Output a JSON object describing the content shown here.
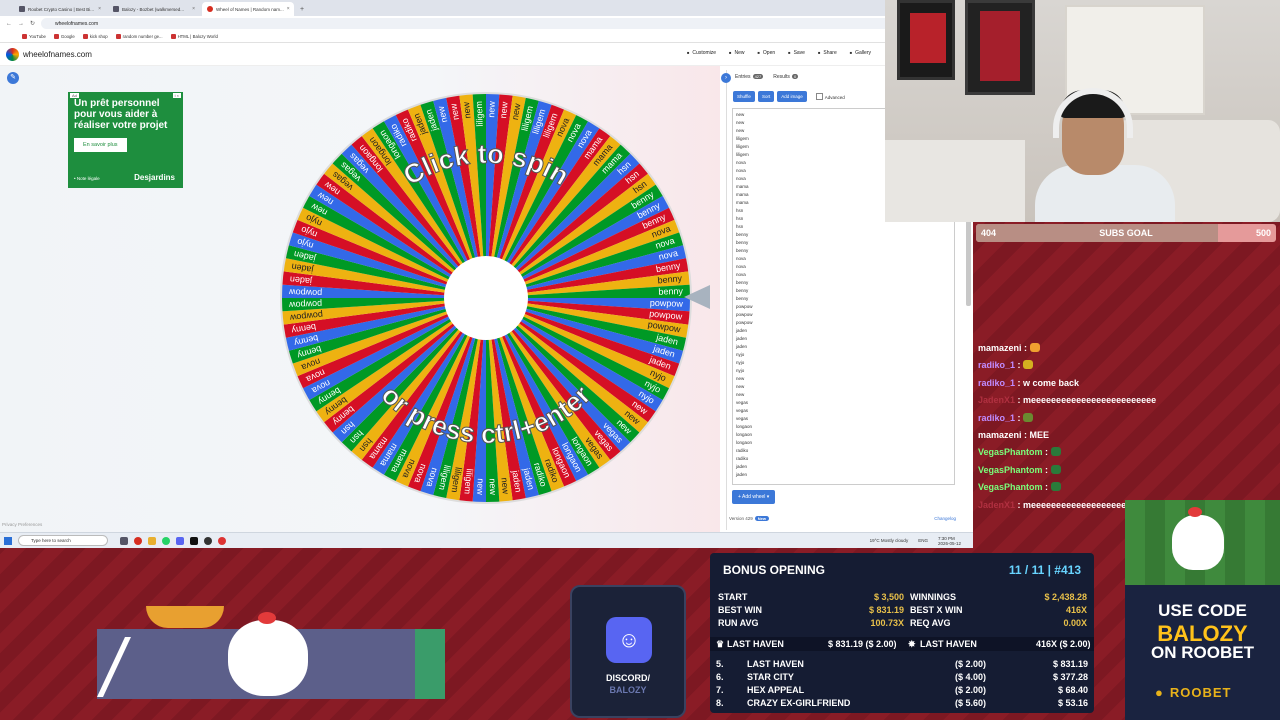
{
  "browser": {
    "tabs": [
      {
        "label": "Roobet Crypto Casino | Best Bi..."
      },
      {
        "label": "Balozy - Bozbet (walkmersed..."
      },
      {
        "label": "Wheel of Names | Random nam...",
        "active": true
      }
    ],
    "url": "wheelofnames.com",
    "bookmarks": [
      "YouTube",
      "Google",
      "kick shop",
      "random number ge...",
      "HTML | Balozy World"
    ]
  },
  "site": {
    "title": "wheelofnames.com",
    "header_buttons": [
      "Customize",
      "New",
      "Open",
      "Save",
      "Share",
      "Gallery"
    ],
    "privacy": "Privacy Preferences"
  },
  "ad": {
    "title": "Un prêt personnel pour vous aider à réaliser votre projet",
    "button": "En savoir plus",
    "footer": "• Note légale",
    "brand": "Desjardins",
    "tag": "Ad"
  },
  "wheel": {
    "text_top": "Click to spin",
    "text_bottom": "or press ctrl+enter",
    "colors": [
      "#3369e8",
      "#d50f25",
      "#eeb211",
      "#009925"
    ]
  },
  "panel": {
    "tab_entries": "Entries",
    "entries_count": "427",
    "tab_results": "Results",
    "results_count": "0",
    "shuffle": "Shuffle",
    "sort": "Sort",
    "add_image": "Add image",
    "advanced": "Advanced",
    "entries": [
      "new",
      "new",
      "new",
      "liligem",
      "liligem",
      "liligem",
      "nova",
      "nova",
      "nova",
      "mama",
      "mama",
      "mama",
      "hsn",
      "hsn",
      "hsn",
      "benny",
      "benny",
      "benny",
      "nova",
      "nova",
      "nova",
      "benny",
      "benny",
      "benny",
      "powpow",
      "powpow",
      "powpow",
      "jaden",
      "jaden",
      "jaden",
      "nyjo",
      "nyjo",
      "nyjo",
      "new",
      "new",
      "new",
      "vegas",
      "vegas",
      "vegas",
      "longaon",
      "longaon",
      "longaon",
      "radiko",
      "radiko",
      "jaden",
      "jaden"
    ],
    "add_wheel": "Add wheel",
    "version": "Version 429",
    "version_badge": "New",
    "changelog": "Changelog"
  },
  "taskbar": {
    "search_placeholder": "Type here to search",
    "weather": "19°C Mostly cloudy",
    "lang": "ENG",
    "time": "7:30 PM",
    "date": "2026-05-12"
  },
  "subs_goal": {
    "current": "404",
    "label": "SUBS GOAL",
    "target": "500",
    "progress": 0.808
  },
  "chat": [
    {
      "user": "mamazeni",
      "text": "",
      "emote": "#f0a030",
      "ucolor": "#ffffff"
    },
    {
      "user": "radiko_1",
      "text": "",
      "emote": "#d4b020",
      "ucolor": "#c08cff"
    },
    {
      "user": "radiko_1",
      "text": "w come back",
      "emote": "",
      "ucolor": "#c08cff"
    },
    {
      "user": "JadenX1",
      "text": "meeeeeeeeeeeeeeeeeeeeeeeee",
      "emote": "",
      "ucolor": "#b03040"
    },
    {
      "user": "radiko_1",
      "text": "",
      "emote": "#6a8a30",
      "ucolor": "#c08cff"
    },
    {
      "user": "mamazeni",
      "text": "MEE",
      "emote": "",
      "ucolor": "#ffffff"
    },
    {
      "user": "VegasPhantom",
      "text": "",
      "emote": "#2a7a3a",
      "ucolor": "#7aff7a"
    },
    {
      "user": "VegasPhantom",
      "text": "",
      "emote": "#2a7a3a",
      "ucolor": "#7aff7a"
    },
    {
      "user": "VegasPhantom",
      "text": "",
      "emote": "#2a7a3a",
      "ucolor": "#7aff7a"
    },
    {
      "user": "JadenX1",
      "text": "meeeeeeeeeeeeeeeeeeeeeeeee",
      "emote": "",
      "ucolor": "#b03040"
    }
  ],
  "promo": {
    "line1": "USE CODE",
    "line2": "BALOZY",
    "line3": "ON ROOBET",
    "brand": "ROOBET"
  },
  "discord": {
    "line1": "DISCORD/",
    "line2": "BALOZY"
  },
  "bonus": {
    "title": "BONUS OPENING",
    "counter": "11 / 11 | #413",
    "start_label": "START",
    "start": "$ 3,500",
    "winnings_label": "WINNINGS",
    "winnings": "$ 2,438.28",
    "bestwin_label": "BEST WIN",
    "bestwin": "$ 831.19",
    "bestx_label": "BEST X WIN",
    "bestx": "416X",
    "runavg_label": "RUN AVG",
    "runavg": "100.73X",
    "reqavg_label": "REQ AVG",
    "reqavg": "0.00X",
    "haven1": "LAST HAVEN",
    "haven1_val": "$ 831.19 ($ 2.00)",
    "haven2": "LAST HAVEN",
    "haven2_val": "416X ($ 2.00)",
    "rows": [
      {
        "num": "5.",
        "name": "LAST HAVEN",
        "bet": "($ 2.00)",
        "win": "$ 831.19"
      },
      {
        "num": "6.",
        "name": "STAR CITY",
        "bet": "($ 4.00)",
        "win": "$ 377.28"
      },
      {
        "num": "7.",
        "name": "HEX APPEAL",
        "bet": "($ 2.00)",
        "win": "$ 68.40"
      },
      {
        "num": "8.",
        "name": "CRAZY EX-GIRLFRIEND",
        "bet": "($ 5.60)",
        "win": "$ 53.16"
      }
    ]
  }
}
